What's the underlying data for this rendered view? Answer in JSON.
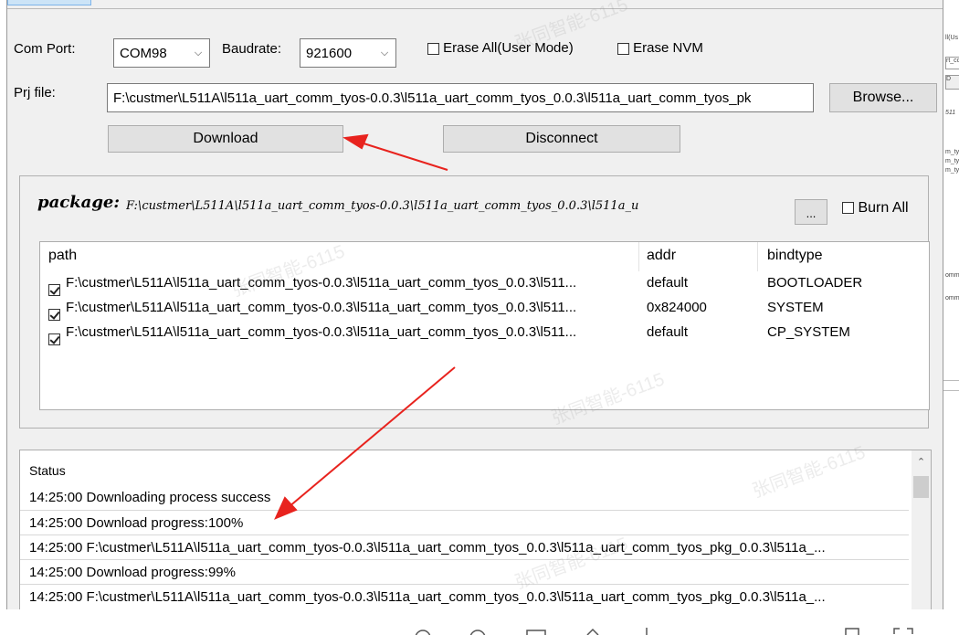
{
  "settings": {
    "com_port_label": "Com Port:",
    "com_port_value": "COM98",
    "baudrate_label": "Baudrate:",
    "baudrate_value": "921600",
    "erase_all_label": "Erase All(User Mode)",
    "erase_nvm_label": "Erase NVM",
    "prj_file_label": "Prj file:",
    "prj_file_value": "F:\\custmer\\L511A\\l511a_uart_comm_tyos-0.0.3\\l511a_uart_comm_tyos_0.0.3\\l511a_uart_comm_tyos_pk",
    "browse_label": "Browse...",
    "download_label": "Download",
    "disconnect_label": "Disconnect"
  },
  "package": {
    "label": "package:",
    "path": "F:\\custmer\\L511A\\l511a_uart_comm_tyos-0.0.3\\l511a_uart_comm_tyos_0.0.3\\l511a_u",
    "more_label": "...",
    "burn_all_label": "Burn All",
    "columns": [
      "path",
      "addr",
      "bindtype"
    ],
    "rows": [
      {
        "checked": true,
        "path": "F:\\custmer\\L511A\\l511a_uart_comm_tyos-0.0.3\\l511a_uart_comm_tyos_0.0.3\\l511...",
        "addr": "default",
        "bindtype": "BOOTLOADER"
      },
      {
        "checked": true,
        "path": "F:\\custmer\\L511A\\l511a_uart_comm_tyos-0.0.3\\l511a_uart_comm_tyos_0.0.3\\l511...",
        "addr": "0x824000",
        "bindtype": "SYSTEM"
      },
      {
        "checked": true,
        "path": "F:\\custmer\\L511A\\l511a_uart_comm_tyos-0.0.3\\l511a_uart_comm_tyos_0.0.3\\l511...",
        "addr": "default",
        "bindtype": "CP_SYSTEM"
      }
    ]
  },
  "status": {
    "header": "Status",
    "lines": [
      "14:25:00 Downloading process success",
      "14:25:00 Download progress:100%",
      "14:25:00 F:\\custmer\\L511A\\l511a_uart_comm_tyos-0.0.3\\l511a_uart_comm_tyos_0.0.3\\l511a_uart_comm_tyos_pkg_0.0.3\\l511a_...",
      "14:25:00 Download progress:99%",
      "14:25:00 F:\\custmer\\L511A\\l511a_uart_comm_tyos-0.0.3\\l511a_uart_comm_tyos_0.0.3\\l511a_uart_comm_tyos_pkg_0.0.3\\l511a_..."
    ]
  },
  "annotation_color": "#e8231e"
}
